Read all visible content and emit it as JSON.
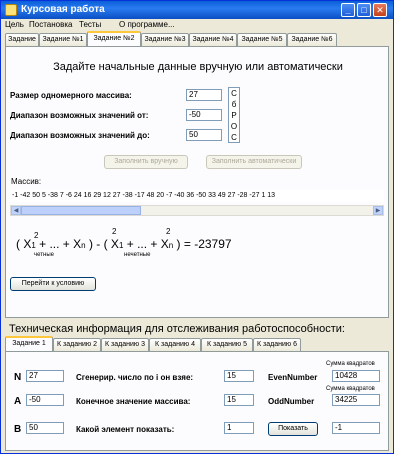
{
  "window": {
    "title": "Курсовая работа"
  },
  "menu": [
    "Цель",
    "Постановка",
    "Тесты",
    "О программе..."
  ],
  "tabs_top": [
    "Задание",
    "Задание №1",
    "Задание №2",
    "Задание №3",
    "Задание №4",
    "Задание №5",
    "Задание №6"
  ],
  "main": {
    "heading": "Задайте начальные данные вручную или автоматически",
    "size_label": "Размер одномерного массива:",
    "size_value": "27",
    "range_from_label": "Диапазон возможных значений от:",
    "range_from_value": "-50",
    "range_to_label": "Диапазон возможных значений до:",
    "range_to_value": "50",
    "vertical_letters": [
      "С",
      "б",
      "Р",
      "О",
      "С"
    ],
    "btn_manual": "Заполнить вручную",
    "btn_auto": "Заполнить автоматически",
    "array_label": "Массив:",
    "array_values": "-1 -42 50 5 -38 7 -6 24 16 29 12 27 -38 -17 48 20 -7 -40 36 -50 33 49 27 -28 -27 1 13",
    "formula": {
      "text": "( X₁ + ... + Xₙ ) - ( X₁ + ... + Xₙ ) = -23797",
      "exp1": "2",
      "exp2": "2",
      "exp3": "2",
      "sub1": "четные",
      "sub2": "нечетные",
      "result": "= -23797"
    },
    "btn_next": "Перейти к условию"
  },
  "tech": {
    "title": "Техническая информация для отслеживания работоспособности:",
    "tabs": [
      "Задание 1",
      "К заданию 2",
      "К заданию 3",
      "К заданию 4",
      "К заданию 5",
      "К заданию 6"
    ],
    "n_label": "N",
    "n_value": "27",
    "a_label": "A",
    "a_value": "-50",
    "b_label": "B",
    "b_value": "50",
    "gen_label": "Сгенерир. число по i он взяе:",
    "gen_value": "15",
    "end_label": "Конечное значение массива:",
    "end_value": "15",
    "show_label": "Какой элемент показать:",
    "show_value": "1",
    "even_caption": "Сумма квадратов",
    "even_label": "EvenNumber",
    "even_value": "10428",
    "odd_caption": "Сумма квадратов",
    "odd_label": "OddNumber",
    "odd_value": "34225",
    "btn_show": "Показать",
    "show_result": "-1"
  }
}
